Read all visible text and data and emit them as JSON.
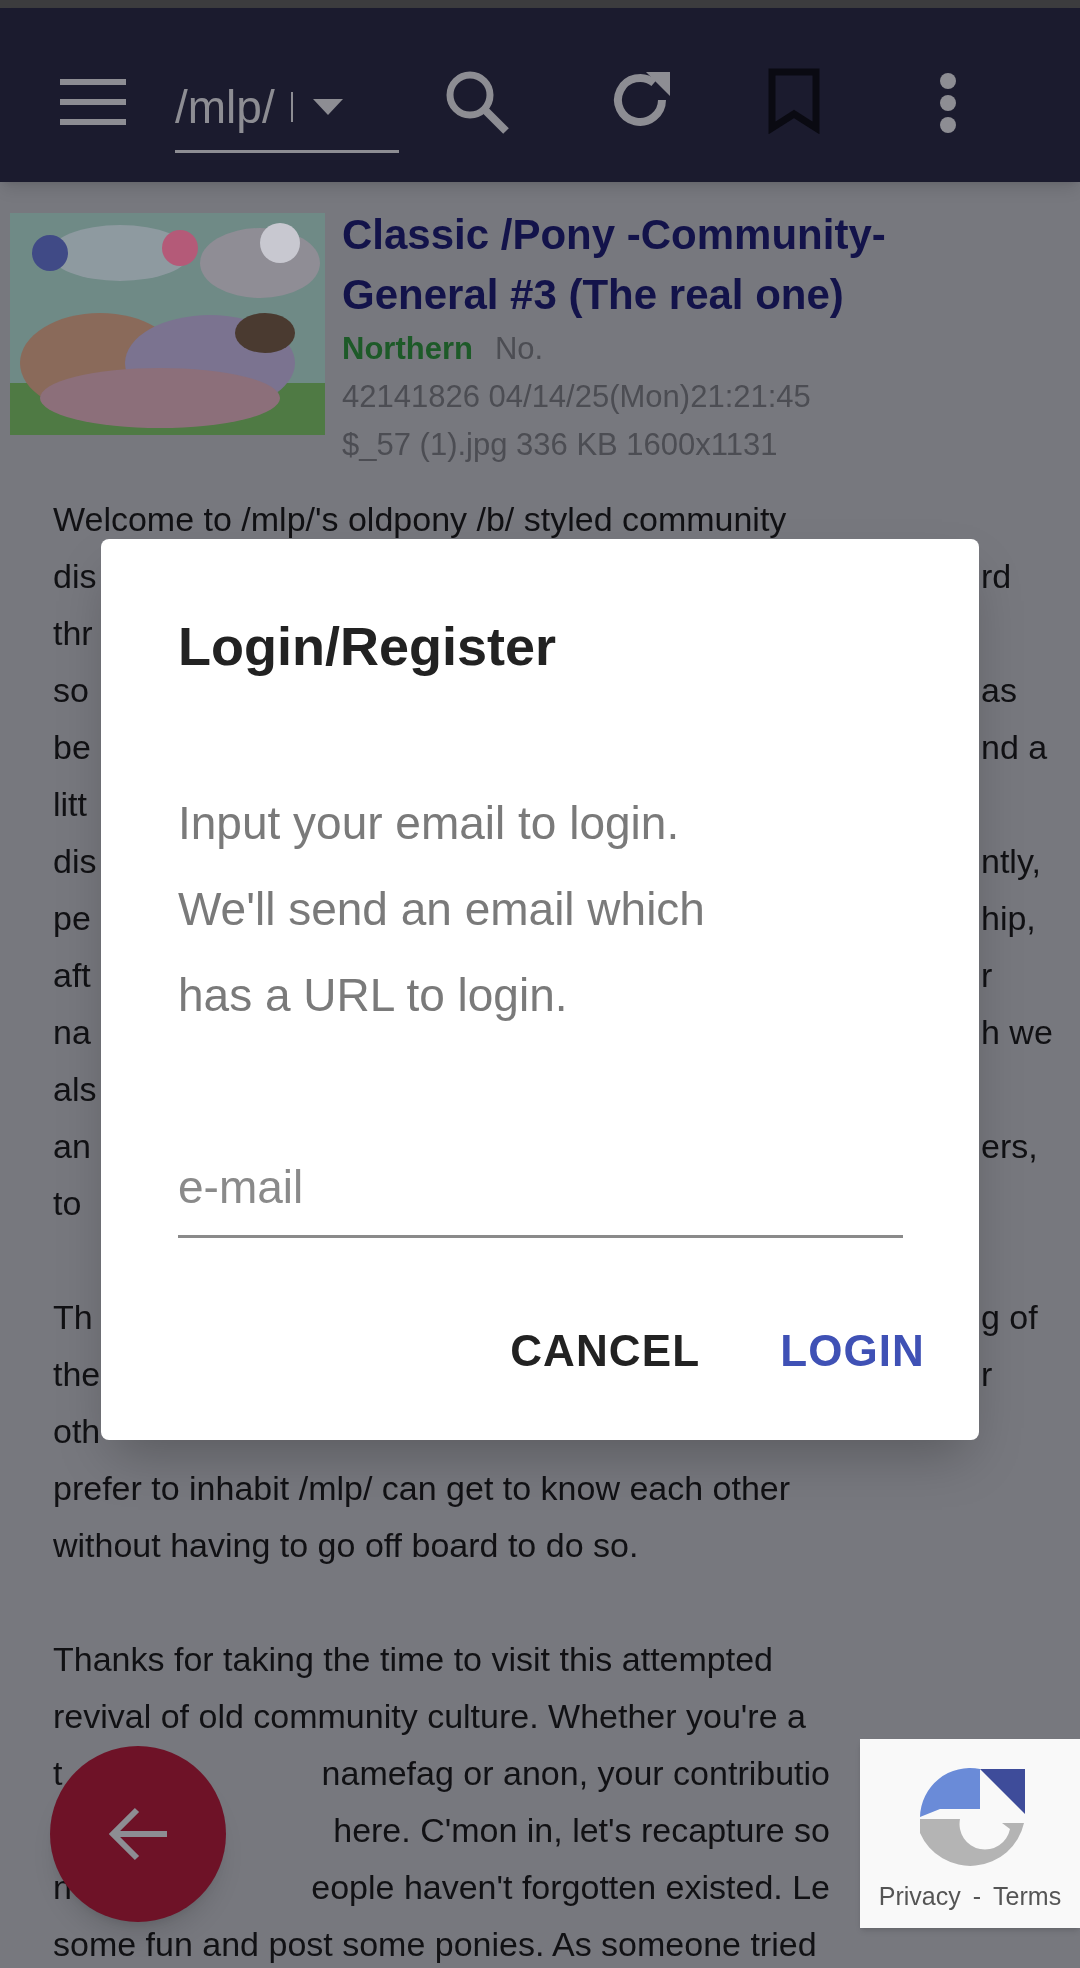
{
  "app_bar": {
    "board": "/mlp/"
  },
  "post": {
    "title": "Classic /Pony -Community- General #3 (The real one)",
    "name": "Northern",
    "number_label": "No.",
    "info": "42141826 04/14/25(Mon)21:21:45",
    "file": "$_57 (1).jpg 336 KB 1600x1131"
  },
  "paragraphs": [
    [
      {
        "kind": "full",
        "left": "Welcome to /mlp/'s oldpony /b/ styled community"
      },
      {
        "kind": "split",
        "left": "dis",
        "right": "rd"
      },
      {
        "kind": "split",
        "left": "thr"
      },
      {
        "kind": "split",
        "left": "so",
        "right": "as"
      },
      {
        "kind": "split",
        "left": "be",
        "right": "nd a"
      },
      {
        "kind": "split",
        "left": "litt"
      },
      {
        "kind": "split",
        "left": "dis",
        "right": "ntly,"
      },
      {
        "kind": "split",
        "left": "pe",
        "right": "hip,"
      },
      {
        "kind": "split",
        "left": "aft",
        "right": "r"
      },
      {
        "kind": "split",
        "left": "na",
        "right": "h we"
      },
      {
        "kind": "split",
        "left": "als"
      },
      {
        "kind": "split",
        "left": "an",
        "right": "ers,"
      },
      {
        "kind": "split",
        "left": "to"
      }
    ],
    [
      {
        "kind": "split",
        "left": "Th",
        "right": "g of"
      },
      {
        "kind": "split",
        "left": "the",
        "right": "r"
      },
      {
        "kind": "split",
        "left": "oth"
      },
      {
        "kind": "full",
        "left": "prefer to inhabit /mlp/ can get to know each other"
      },
      {
        "kind": "full",
        "left": "without having to go off board to do so."
      }
    ],
    [
      {
        "kind": "full",
        "left": "Thanks for taking the time to visit this attempted"
      },
      {
        "kind": "full",
        "left": "revival of old community culture. Whether you're a"
      },
      {
        "kind": "fab",
        "left": "t",
        "right": "namefag or anon, your contributio"
      },
      {
        "kind": "fab",
        "right": "here. C'mon in, let's recapture so"
      },
      {
        "kind": "fab",
        "left": "n",
        "right": "eople haven't forgotten existed. Le"
      },
      {
        "kind": "full",
        "left": "some fun and post some ponies. As someone tried"
      }
    ]
  ],
  "dialog": {
    "title": "Login/Register",
    "message": "Input your email to login. We'll send an email which has a URL to login.",
    "email": {
      "placeholder": "e-mail"
    },
    "buttons": [
      {
        "label": "CANCEL",
        "kind": "neutral"
      },
      {
        "label": "LOGIN",
        "kind": "primary"
      }
    ]
  },
  "recaptcha": {
    "links": [
      "Privacy",
      "Terms"
    ],
    "separator": "-"
  }
}
